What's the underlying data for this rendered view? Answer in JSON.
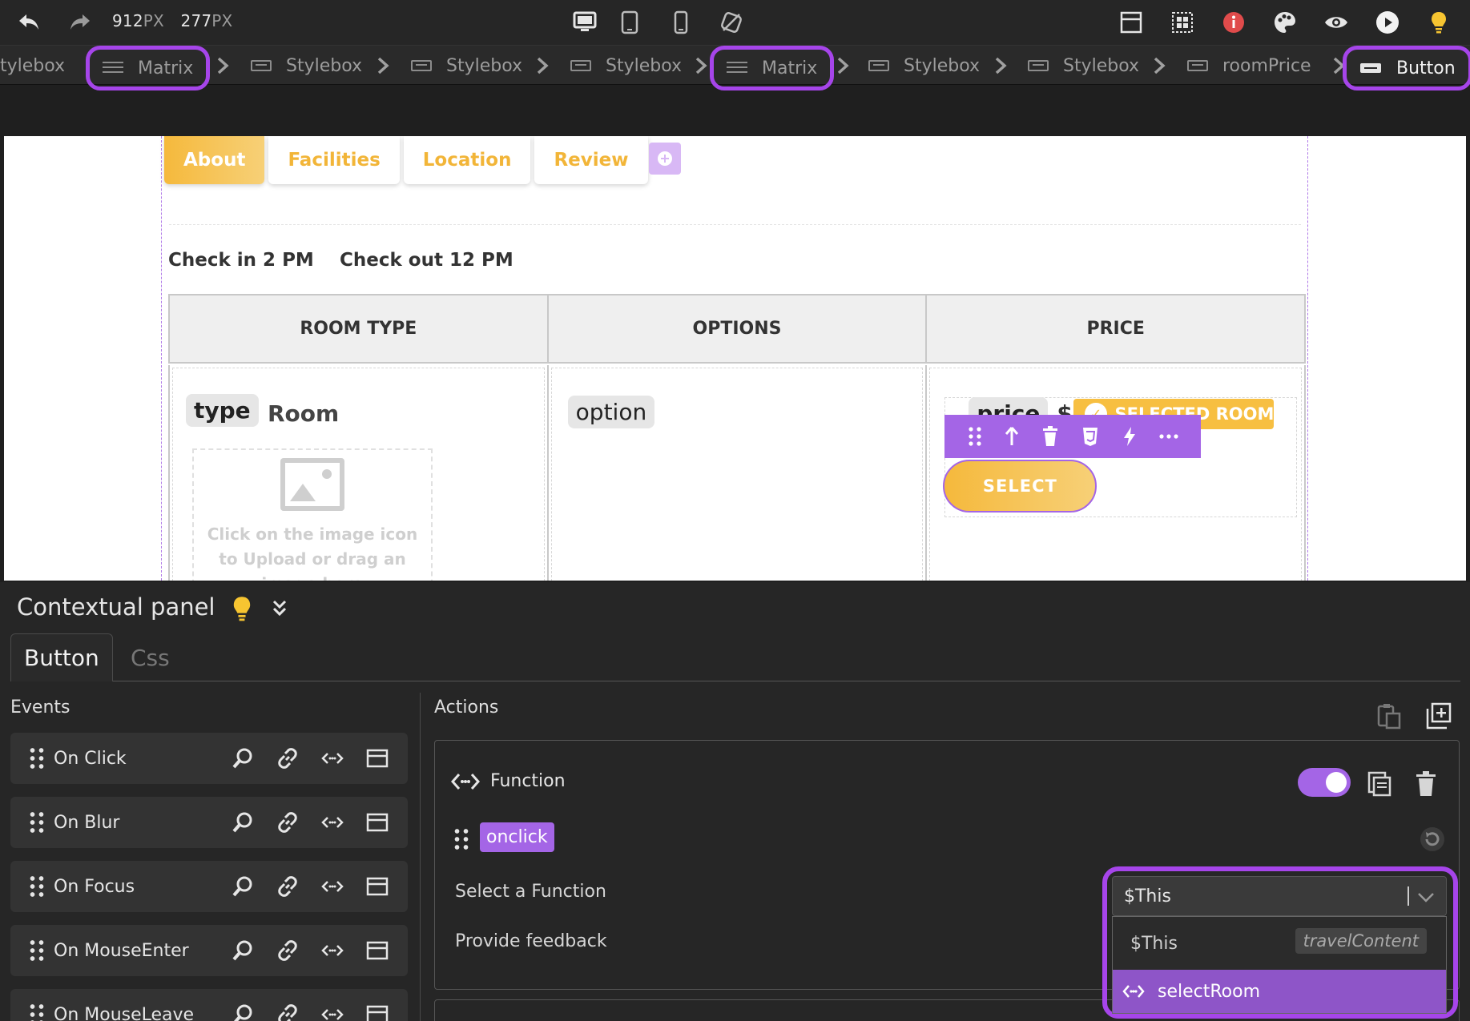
{
  "toolbar": {
    "width_value": "912",
    "height_value": "277",
    "unit": "PX",
    "icons": [
      "undo-icon",
      "redo-icon",
      "desktop-icon",
      "tablet-icon",
      "mobile-icon",
      "no-device-icon",
      "layout-icon",
      "grid-icon",
      "info-icon",
      "palette-icon",
      "preview-eye-icon",
      "play-icon",
      "bulb-icon"
    ],
    "colors": {
      "info": "#e04b4b",
      "bulb": "#f7c531"
    }
  },
  "breadcrumb": [
    {
      "label": "tylebox",
      "type": "stylebox"
    },
    {
      "label": "Matrix",
      "type": "matrix",
      "highlighted": true
    },
    {
      "label": "Stylebox",
      "type": "stylebox"
    },
    {
      "label": "Stylebox",
      "type": "stylebox"
    },
    {
      "label": "Stylebox",
      "type": "stylebox"
    },
    {
      "label": "Matrix",
      "type": "matrix",
      "highlighted": true
    },
    {
      "label": "Stylebox",
      "type": "stylebox"
    },
    {
      "label": "Stylebox",
      "type": "stylebox"
    },
    {
      "label": "roomPrice",
      "type": "stylebox"
    },
    {
      "label": "Button",
      "type": "button",
      "highlighted": true,
      "current": true
    }
  ],
  "canvas": {
    "tabs": [
      {
        "label": "About",
        "active": true
      },
      {
        "label": "Facilities",
        "active": false
      },
      {
        "label": "Location",
        "active": false
      },
      {
        "label": "Review",
        "active": false
      }
    ],
    "check_in": "Check in 2 PM",
    "check_out": "Check out 12 PM",
    "table_headers": [
      "ROOM TYPE",
      "OPTIONS",
      "PRICE"
    ],
    "type_chip": "type",
    "room_word": "Room",
    "image_hint": "Click on the image icon to Upload or drag an image here",
    "option_chip": "option",
    "price_chip": "price",
    "currency": "$",
    "selected_room": "SELECTED ROOM",
    "select_button": "SELECT",
    "colors": {
      "accent": "#f5b93c",
      "selection": "#a465e6"
    }
  },
  "panel": {
    "title": "Contextual panel",
    "tabs": [
      {
        "label": "Button",
        "active": true
      },
      {
        "label": "Css",
        "active": false
      }
    ],
    "events_title": "Events",
    "events": [
      {
        "label": "On Click"
      },
      {
        "label": "On Blur"
      },
      {
        "label": "On Focus"
      },
      {
        "label": "On MouseEnter"
      },
      {
        "label": "On MouseLeave"
      }
    ],
    "actions_title": "Actions",
    "action": {
      "type_label": "Function",
      "enabled": true,
      "event_chip": "onclick",
      "select_label": "Select a Function",
      "feedback_label": "Provide feedback",
      "selected_value": "$This",
      "options": [
        {
          "label": "$This",
          "tag": "travelContent"
        },
        {
          "label": "selectRoom",
          "highlighted": true
        }
      ]
    },
    "colors": {
      "accent": "#a465e6",
      "highlight_ring": "#a645ea"
    }
  }
}
